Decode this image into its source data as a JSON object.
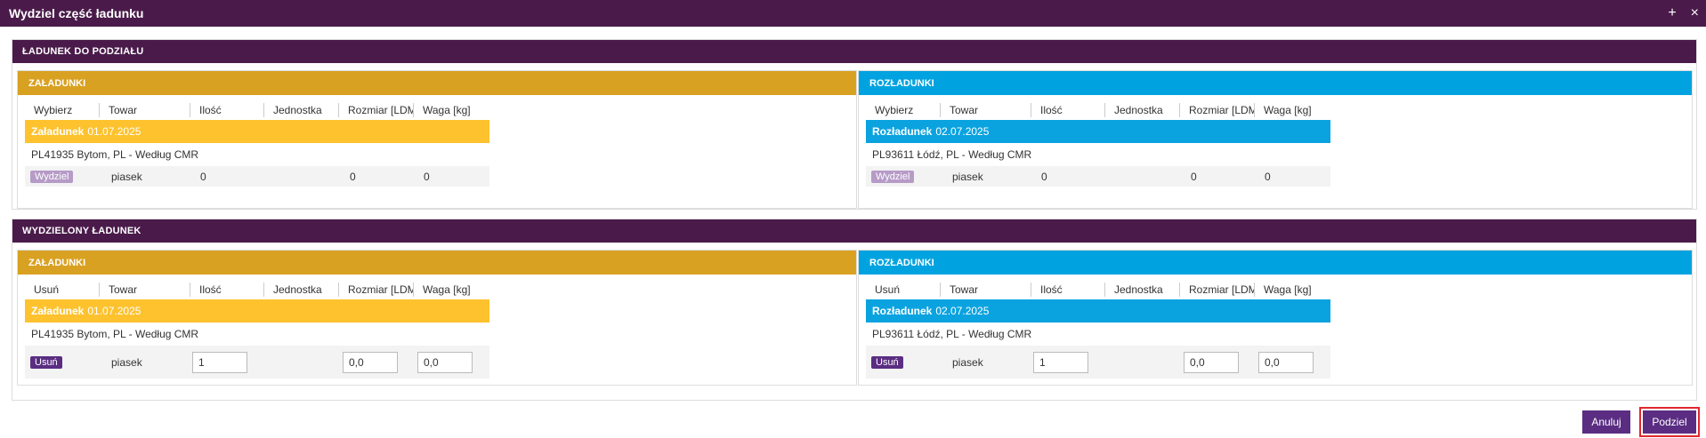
{
  "window": {
    "title": "Wydziel część ładunku",
    "add_icon": "+",
    "close_icon": "×"
  },
  "section1": {
    "title": "ŁADUNEK DO PODZIAŁU",
    "loads": {
      "header": "ZAŁADUNKI",
      "columns": [
        "Wybierz",
        "Towar",
        "Ilość",
        "Jednostka",
        "Rozmiar [LDM]",
        "Waga [kg]"
      ],
      "group_label": "Załadunek",
      "group_date": "01.07.2025",
      "location": "PL41935 Bytom, PL - Według CMR",
      "row": {
        "action": "Wydziel",
        "towar": "piasek",
        "ilosc": "0",
        "jednostka": "",
        "rozmiar": "0",
        "waga": "0"
      }
    },
    "unloads": {
      "header": "ROZŁADUNKI",
      "columns": [
        "Wybierz",
        "Towar",
        "Ilość",
        "Jednostka",
        "Rozmiar [LDM]",
        "Waga [kg]"
      ],
      "group_label": "Rozładunek",
      "group_date": "02.07.2025",
      "location": "PL93611 Łódź, PL - Według CMR",
      "row": {
        "action": "Wydziel",
        "towar": "piasek",
        "ilosc": "0",
        "jednostka": "",
        "rozmiar": "0",
        "waga": "0"
      }
    }
  },
  "section2": {
    "title": "WYDZIELONY ŁADUNEK",
    "loads": {
      "header": "ZAŁADUNKI",
      "columns": [
        "Usuń",
        "Towar",
        "Ilość",
        "Jednostka",
        "Rozmiar [LDM]",
        "Waga [kg]"
      ],
      "group_label": "Załadunek",
      "group_date": "01.07.2025",
      "location": "PL41935 Bytom, PL - Według CMR",
      "row": {
        "action": "Usuń",
        "towar": "piasek",
        "ilosc": "1",
        "rozmiar": "0,0",
        "waga": "0,0"
      }
    },
    "unloads": {
      "header": "ROZŁADUNKI",
      "columns": [
        "Usuń",
        "Towar",
        "Ilość",
        "Jednostka",
        "Rozmiar [LDM]",
        "Waga [kg]"
      ],
      "group_label": "Rozładunek",
      "group_date": "02.07.2025",
      "location": "PL93611 Łódź, PL - Według CMR",
      "row": {
        "action": "Usuń",
        "towar": "piasek",
        "ilosc": "1",
        "rozmiar": "0,0",
        "waga": "0,0"
      }
    }
  },
  "footer": {
    "cancel_label": "Anuluj",
    "split_label": "Podziel"
  },
  "colors": {
    "header": "#4a1b4a",
    "loads": "#d9a122",
    "unloads": "#00a3e0",
    "button": "#5a2d82"
  }
}
